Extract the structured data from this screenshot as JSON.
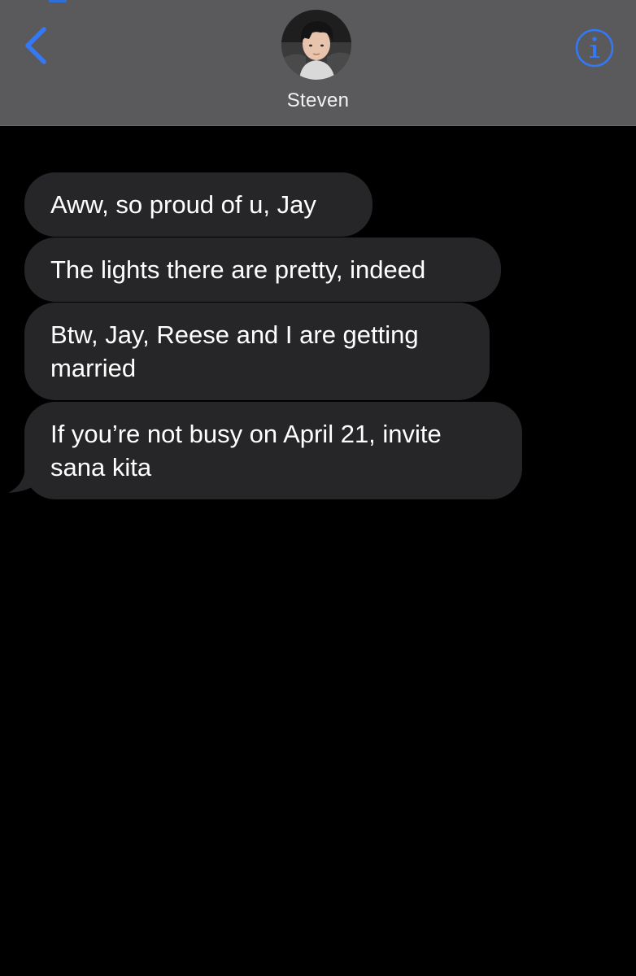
{
  "header": {
    "contact_name": "Steven",
    "back_icon": "chevron-left-icon",
    "info_icon": "info-circle-icon",
    "accent_color": "#3478f6"
  },
  "messages": [
    {
      "direction": "incoming",
      "text": "Aww, so proud of u, Jay"
    },
    {
      "direction": "incoming",
      "text": "The lights there are pretty, indeed"
    },
    {
      "direction": "incoming",
      "text": "Btw, Jay, Reese and I are getting married"
    },
    {
      "direction": "incoming",
      "text": "If you’re not busy on April 21, invite sana kita"
    }
  ],
  "colors": {
    "background": "#000000",
    "header_background": "#5a5a5c",
    "incoming_bubble": "#262628",
    "text": "#ffffff"
  }
}
